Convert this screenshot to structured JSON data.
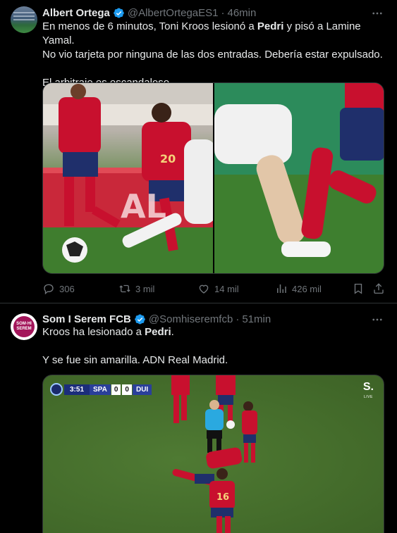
{
  "tweets": [
    {
      "name": "Albert Ortega",
      "handle": "@AlbertOrtegaES1",
      "separator": "·",
      "time": "46min",
      "text": [
        [
          "En menos de 6 minutos, Toni Kroos lesionó a ",
          "Pedri",
          " y pisó a Lamine Yamal."
        ],
        [
          "No vio tarjeta por ninguna de las dos entradas. Debería estar expulsado."
        ],
        [
          ""
        ],
        [
          "El arbitraje es escandaloso."
        ]
      ],
      "media": {
        "left_jersey_number": "20",
        "left_board_text": "AL"
      },
      "metrics": {
        "replies": "306",
        "retweets": "3 mil",
        "likes": "14 mil",
        "views": "426 mil"
      }
    },
    {
      "name": "Som I Serem FCB",
      "handle": "@Somhiseremfcb",
      "separator": "·",
      "time": "51min",
      "avatar_text": [
        "SOM·HI",
        "SEREM"
      ],
      "text": [
        [
          "Kroos ha lesionado a ",
          "Pedri",
          "."
        ],
        [
          ""
        ],
        [
          "Y se fue sin amarilla. ADN Real Madrid."
        ]
      ],
      "scorebug": {
        "clock": "3:51",
        "home": "SPA",
        "home_score": "0",
        "away_score": "0",
        "away": "DUI"
      },
      "broadcaster": {
        "logo": "S.",
        "tag": "LIVE"
      },
      "media": {
        "player_number": "16"
      }
    }
  ],
  "icons": {
    "verified": "verified-badge-icon",
    "more": "more-options-icon",
    "reply": "reply-icon",
    "retweet": "retweet-icon",
    "like": "like-icon",
    "views": "views-icon",
    "bookmark": "bookmark-icon",
    "share": "share-icon"
  },
  "colors": {
    "background": "#000000",
    "text": "#e7e9ea",
    "secondary": "#71767b",
    "verified": "#1d9bf0",
    "divider": "#2f3336"
  }
}
